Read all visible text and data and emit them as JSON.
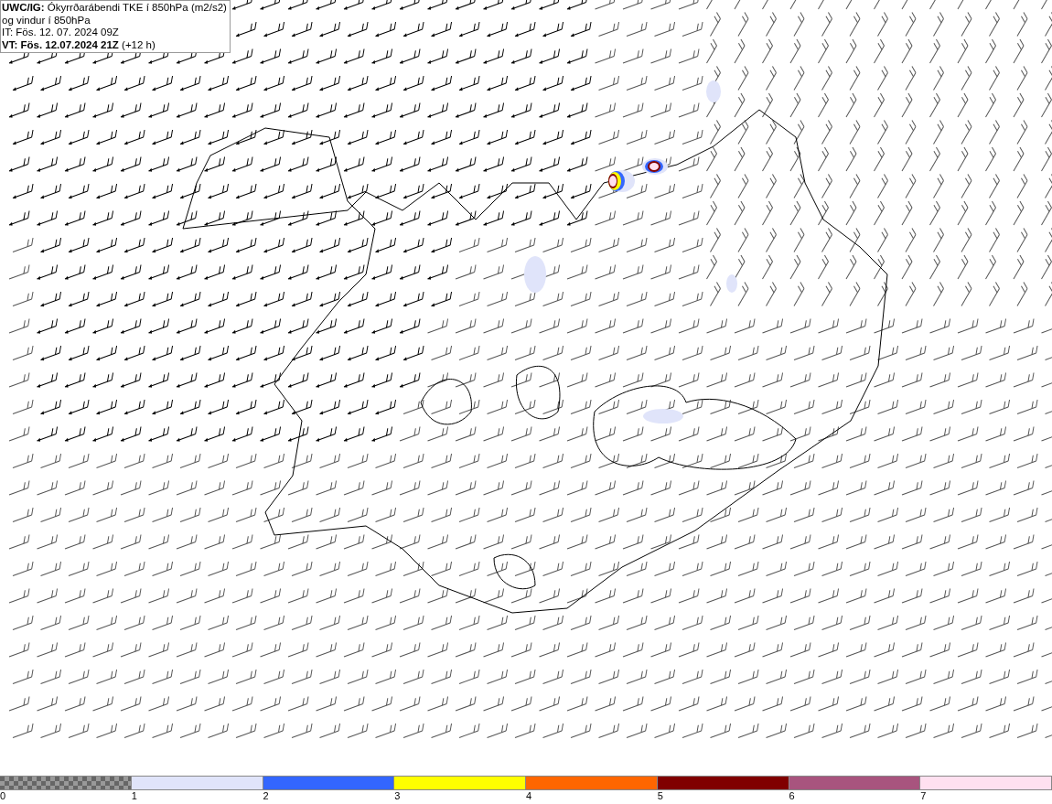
{
  "header": {
    "lines": [
      "**UWC/IG:** Ókyrrðarábendi TKE í 850hPa (m2/s2)",
      "og vindur í 850hPa",
      "IT: Fös. 12. 07. 2024 09Z",
      "**VT: Fös. 12.07.2024 21Z** (+12 h)"
    ]
  },
  "legend": {
    "segments": [
      {
        "kind": "checker"
      },
      {
        "kind": "solid",
        "color": "#e0e4fa"
      },
      {
        "kind": "solid",
        "color": "#3366ff"
      },
      {
        "kind": "solid",
        "color": "#ffff00"
      },
      {
        "kind": "solid",
        "color": "#ff6600"
      },
      {
        "kind": "solid",
        "color": "#800000"
      },
      {
        "kind": "solid",
        "color": "#a8547e"
      },
      {
        "kind": "solid",
        "color": "#ffe0f0"
      }
    ],
    "ticks": [
      "0",
      "1",
      "2",
      "3",
      "4",
      "5",
      "6",
      "7"
    ]
  }
}
